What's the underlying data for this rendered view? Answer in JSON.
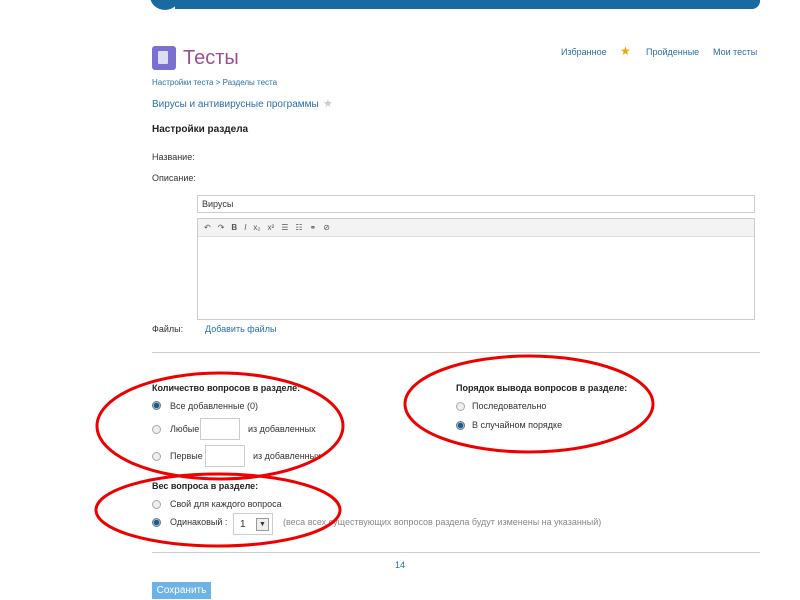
{
  "header": {
    "title": "Тесты",
    "nav": [
      "Избранное",
      "Пройденные",
      "Мои тесты"
    ]
  },
  "breadcrumb": "Настройки теста > Разделы теста",
  "test_name": "Вирусы и антивирусные программы",
  "section_title": "Настройки раздела",
  "form": {
    "name_label": "Название:",
    "desc_label": "Описание:",
    "name_value": "Вирусы",
    "files_label": "Файлы:",
    "add_files": "Добавить файлы",
    "toolbar": [
      "↶",
      "↷",
      "B",
      "I",
      "x₂",
      "x²",
      "☰",
      "☷",
      "⚭",
      "⊘"
    ]
  },
  "count": {
    "title": "Количество вопросов в разделе:",
    "all": "Все добавленные (0)",
    "any": "Любые",
    "first": "Первые",
    "of_added": "из добавленных",
    "selected": "all"
  },
  "order": {
    "title": "Порядок вывода вопросов в разделе:",
    "sequential": "Последовательно",
    "random": "В случайном порядке",
    "selected": "random"
  },
  "weight": {
    "title": "Вес вопроса в разделе:",
    "own": "Свой для каждого вопроса",
    "same": "Одинаковый :",
    "value": "1",
    "note": "(веса всех существующих вопросов раздела будут изменены на указанный)",
    "selected": "same"
  },
  "page_number": "14",
  "save": "Сохранить"
}
